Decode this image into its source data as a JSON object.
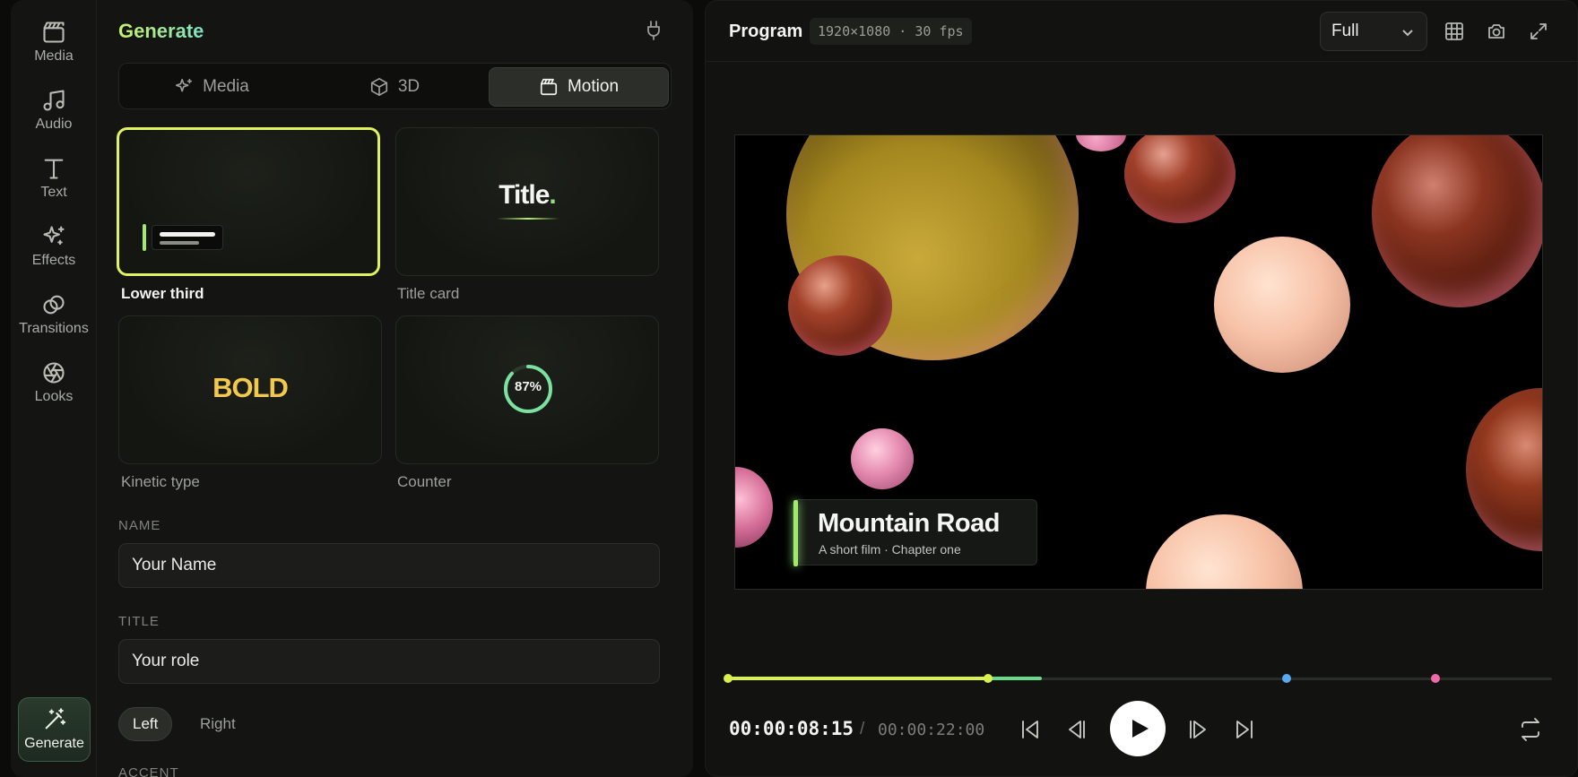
{
  "rail": {
    "items": [
      {
        "label": "Media",
        "icon": "clapperboard-icon"
      },
      {
        "label": "Audio",
        "icon": "music-note-icon"
      },
      {
        "label": "Text",
        "icon": "text-icon"
      },
      {
        "label": "Effects",
        "icon": "sparkles-icon"
      },
      {
        "label": "Transitions",
        "icon": "transitions-icon"
      },
      {
        "label": "Looks",
        "icon": "aperture-icon"
      }
    ],
    "generate_label": "Generate"
  },
  "panel": {
    "title": "Generate",
    "tabs": [
      {
        "label": "Media",
        "icon": "sparkles-icon"
      },
      {
        "label": "3D",
        "icon": "cube-icon"
      },
      {
        "label": "Motion",
        "icon": "clapperboard-icon",
        "active": true
      }
    ],
    "presets": [
      {
        "label": "Lower third",
        "selected": true
      },
      {
        "label": "Title card",
        "preview_text": "Title",
        "preview_dot": "."
      },
      {
        "label": "Kinetic type",
        "preview_text": "BOLD"
      },
      {
        "label": "Counter",
        "preview_text": "87%",
        "progress": 0.87
      }
    ],
    "name_label": "NAME",
    "name_value": "Your Name",
    "title_label": "TITLE",
    "title_value": "Your role",
    "align_options": [
      "Left",
      "Right"
    ],
    "align_selected": "Left",
    "accent_label": "ACCENT"
  },
  "program": {
    "title": "Program",
    "spec": "1920×1080 · 30 fps",
    "zoom": "Full",
    "overlay_title": "Mountain Road",
    "overlay_subtitle": "A short film · Chapter one",
    "timecode_current": "00:00:08:15",
    "timecode_separator": "/",
    "timecode_total": "00:00:22:00",
    "playhead_fraction": 0.31,
    "accent_colors": {
      "lime": "#d9f04f",
      "green": "#8fe07a",
      "blue": "#5aa9f0",
      "pink": "#f06aa8"
    }
  }
}
